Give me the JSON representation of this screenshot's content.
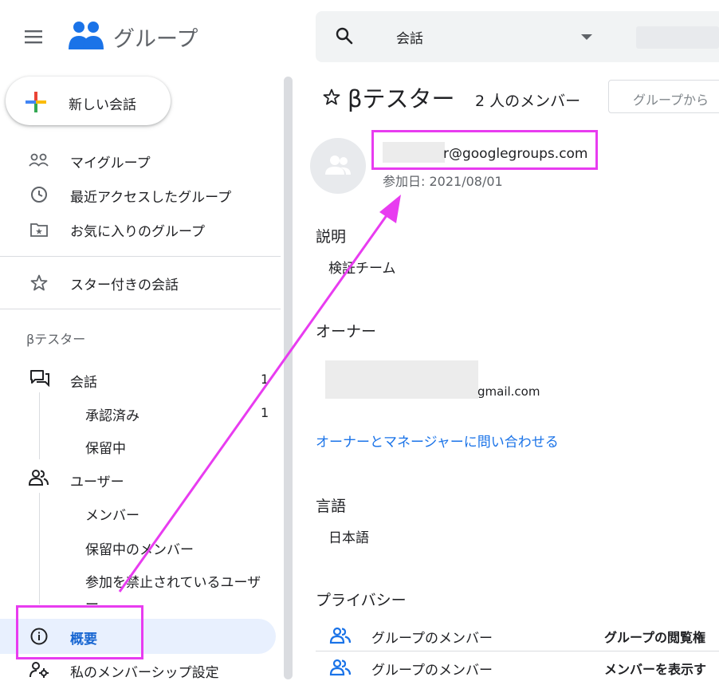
{
  "app": {
    "title": "グループ"
  },
  "search": {
    "scope_label": "会話"
  },
  "sidebar": {
    "new_conversation": "新しい会話",
    "nav_items": [
      {
        "label": "マイグループ"
      },
      {
        "label": "最近アクセスしたグループ"
      },
      {
        "label": "お気に入りのグループ"
      },
      {
        "label": "スター付きの会話"
      }
    ],
    "group_name": "βテスター",
    "conversations": {
      "label": "会話",
      "count": "1"
    },
    "approved": {
      "label": "承認済み",
      "count": "1"
    },
    "pending": {
      "label": "保留中"
    },
    "users": {
      "label": "ユーザー"
    },
    "members": {
      "label": "メンバー"
    },
    "pending_members": {
      "label": "保留中のメンバー"
    },
    "banned_users": {
      "label": "参加を禁止されているユーザー"
    },
    "about": {
      "label": "概要"
    },
    "membership_settings": {
      "label": "私のメンバーシップ設定"
    }
  },
  "main": {
    "group_title": "βテスター",
    "member_count": "2 人のメンバー",
    "group_button": "グループから",
    "email": "r@googlegroups.com",
    "joined": "参加日: 2021/08/01",
    "description_heading": "説明",
    "description": "検証チーム",
    "owner_heading": "オーナー",
    "owner_email": "gmail.com",
    "contact_link": "オーナーとマネージャーに問い合わせる",
    "language_heading": "言語",
    "language": "日本語",
    "privacy_heading": "プライバシー",
    "privacy_rows": [
      {
        "who": "グループのメンバー",
        "what": "グループの閲覧権"
      },
      {
        "who": "グループのメンバー",
        "what": "メンバーを表示す"
      }
    ]
  },
  "colors": {
    "annotation": "#e83cf0",
    "link": "#1a73e8",
    "active_bg": "#e8f0fe",
    "active_text": "#1967d2"
  }
}
